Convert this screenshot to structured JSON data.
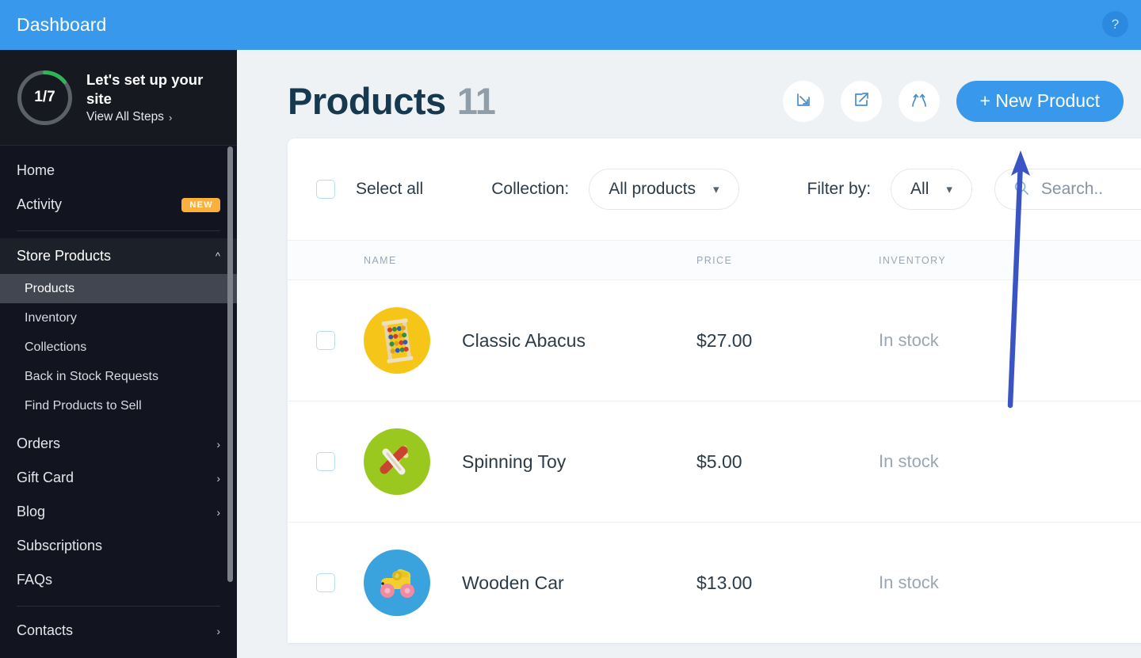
{
  "topbar": {
    "title": "Dashboard",
    "help_icon": "question-mark-icon",
    "background": "#3899ec"
  },
  "sidebar": {
    "setup": {
      "progress_label": "1/7",
      "progress_current": 1,
      "progress_total": 7,
      "title": "Let's set up your site",
      "link_label": "View All Steps",
      "chevron": "›",
      "arc_color": "#2fb457",
      "track_color": "#5c6068"
    },
    "items": [
      {
        "label": "Home",
        "type": "link"
      },
      {
        "label": "Activity",
        "type": "link",
        "badge": "NEW"
      }
    ],
    "section": {
      "label": "Store Products",
      "caret": "chevron-up-icon",
      "expanded": true,
      "children": [
        {
          "label": "Products",
          "active": true
        },
        {
          "label": "Inventory",
          "active": false
        },
        {
          "label": "Collections",
          "active": false
        },
        {
          "label": "Back in Stock Requests",
          "active": false
        },
        {
          "label": "Find Products to Sell",
          "active": false
        }
      ]
    },
    "items_lower": [
      {
        "label": "Orders",
        "arrow": "›"
      },
      {
        "label": "Gift Card",
        "arrow": "›"
      },
      {
        "label": "Blog",
        "arrow": "›"
      },
      {
        "label": "Subscriptions",
        "arrow": ""
      },
      {
        "label": "FAQs",
        "arrow": ""
      }
    ],
    "items_bottom": [
      {
        "label": "Contacts",
        "arrow": "›"
      }
    ]
  },
  "page": {
    "title": "Products",
    "count": "11",
    "actions": [
      {
        "name": "import-button",
        "icon": "arrow-into-box-icon"
      },
      {
        "name": "export-button",
        "icon": "arrow-out-of-box-icon"
      },
      {
        "name": "sync-button",
        "icon": "merge-arrows-icon"
      }
    ],
    "new_button": "+ New Product"
  },
  "filters": {
    "select_all_label": "Select all",
    "collection_label": "Collection:",
    "collection_value": "All products",
    "filter_label": "Filter by:",
    "filter_value": "All",
    "search_placeholder": "Search..",
    "search_icon": "magnifier-icon",
    "caret_icon": "chevron-down-icon"
  },
  "table": {
    "columns": [
      "NAME",
      "PRICE",
      "INVENTORY"
    ],
    "rows": [
      {
        "name": "Classic Abacus",
        "price": "$27.00",
        "inventory": "In stock",
        "thumb_bg": "#f5c518",
        "thumb_icon": "abacus-thumbnail"
      },
      {
        "name": "Spinning Toy",
        "price": "$5.00",
        "inventory": "In stock",
        "thumb_bg": "#9ac81f",
        "thumb_icon": "spinning-top-thumbnail"
      },
      {
        "name": "Wooden Car",
        "price": "$13.00",
        "inventory": "In stock",
        "thumb_bg": "#3aa3dd",
        "thumb_icon": "toy-car-thumbnail"
      }
    ]
  },
  "annotation": {
    "arrow_color": "#3b54c4",
    "points_to": "new-product-button"
  }
}
